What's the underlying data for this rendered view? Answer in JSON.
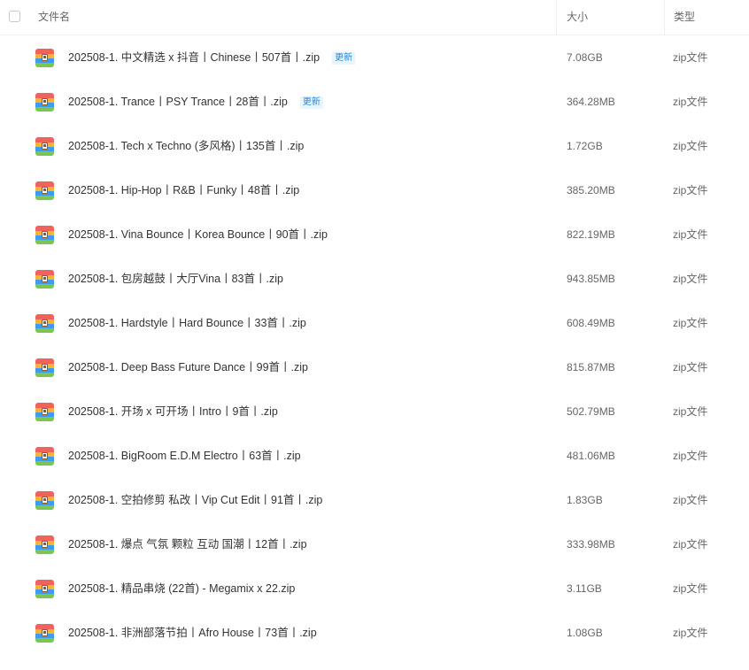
{
  "header": {
    "name_label": "文件名",
    "size_label": "大小",
    "type_label": "类型"
  },
  "icon": "zip-archive-icon",
  "badge_color": "#1e88e5",
  "files": [
    {
      "name": "202508-1. 中文精选 x 抖音丨Chinese丨507首丨.zip",
      "badge": "更新",
      "size": "7.08GB",
      "type": "zip文件"
    },
    {
      "name": "202508-1. Trance丨PSY Trance丨28首丨.zip",
      "badge": "更新",
      "size": "364.28MB",
      "type": "zip文件"
    },
    {
      "name": "202508-1. Tech x Techno (多风格)丨135首丨.zip",
      "badge": "",
      "size": "1.72GB",
      "type": "zip文件"
    },
    {
      "name": "202508-1. Hip-Hop丨R&B丨Funky丨48首丨.zip",
      "badge": "",
      "size": "385.20MB",
      "type": "zip文件"
    },
    {
      "name": "202508-1. Vina Bounce丨Korea Bounce丨90首丨.zip",
      "badge": "",
      "size": "822.19MB",
      "type": "zip文件"
    },
    {
      "name": "202508-1. 包房越鼓丨大厅Vina丨83首丨.zip",
      "badge": "",
      "size": "943.85MB",
      "type": "zip文件"
    },
    {
      "name": "202508-1. Hardstyle丨Hard Bounce丨33首丨.zip",
      "badge": "",
      "size": "608.49MB",
      "type": "zip文件"
    },
    {
      "name": "202508-1. Deep Bass Future Dance丨99首丨.zip",
      "badge": "",
      "size": "815.87MB",
      "type": "zip文件"
    },
    {
      "name": "202508-1. 开场 x 可开场丨Intro丨9首丨.zip",
      "badge": "",
      "size": "502.79MB",
      "type": "zip文件"
    },
    {
      "name": "202508-1. BigRoom E.D.M Electro丨63首丨.zip",
      "badge": "",
      "size": "481.06MB",
      "type": "zip文件"
    },
    {
      "name": "202508-1. 空拍修剪 私改丨Vip Cut Edit丨91首丨.zip",
      "badge": "",
      "size": "1.83GB",
      "type": "zip文件"
    },
    {
      "name": "202508-1. 爆点 气氛 颗粒 互动 国潮丨12首丨.zip",
      "badge": "",
      "size": "333.98MB",
      "type": "zip文件"
    },
    {
      "name": "202508-1. 精品串烧 (22首) - Megamix x 22.zip",
      "badge": "",
      "size": "3.11GB",
      "type": "zip文件"
    },
    {
      "name": "202508-1. 非洲部落节拍丨Afro House丨73首丨.zip",
      "badge": "",
      "size": "1.08GB",
      "type": "zip文件"
    }
  ]
}
